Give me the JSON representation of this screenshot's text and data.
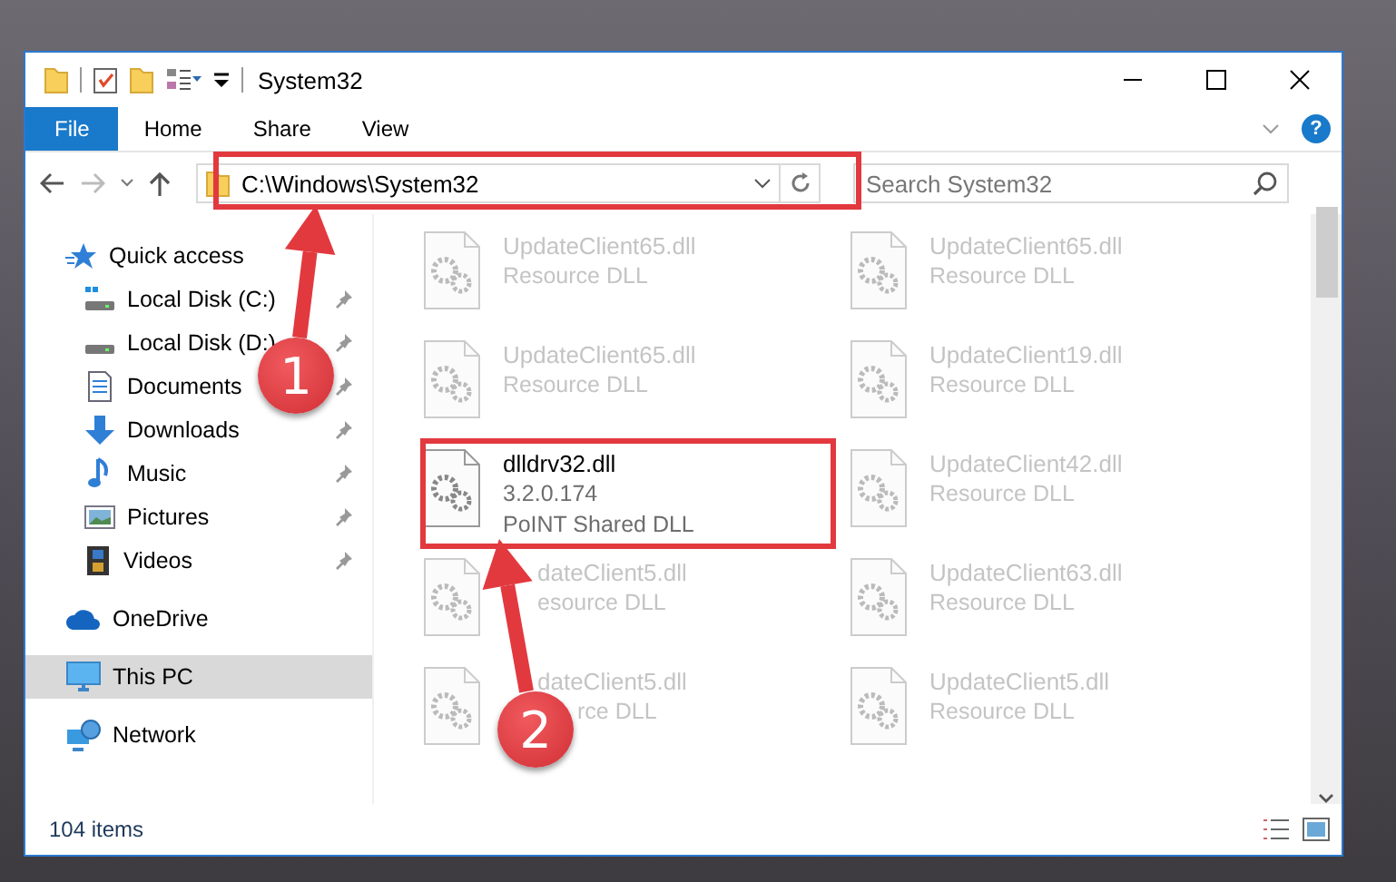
{
  "window": {
    "title": "System32",
    "controls": [
      {
        "kind": "minimize"
      },
      {
        "kind": "maximize"
      },
      {
        "kind": "close"
      }
    ]
  },
  "ribbon_tabs": [
    {
      "label": "File",
      "kind": "file",
      "selected": false
    },
    {
      "label": "Home",
      "kind": "tab",
      "selected": false
    },
    {
      "label": "Share",
      "kind": "tab",
      "selected": false
    },
    {
      "label": "View",
      "kind": "tab",
      "selected": false
    }
  ],
  "help_button": {
    "label": "?"
  },
  "address_bar": {
    "path": "C:\\Windows\\System32"
  },
  "search": {
    "placeholder": "Search System32"
  },
  "sidebar": {
    "items": [
      {
        "label": "Quick access",
        "kind": "star",
        "selected": false,
        "children": [
          {
            "label": "Local Disk (C:)",
            "kind": "system-drive",
            "pinned": true,
            "selected": false
          },
          {
            "label": "Local Disk (D:)",
            "kind": "drive",
            "pinned": true,
            "selected": false
          },
          {
            "label": "Documents",
            "kind": "documents",
            "pinned": true,
            "selected": false
          },
          {
            "label": "Downloads",
            "kind": "downloads",
            "pinned": true,
            "selected": false
          },
          {
            "label": "Music",
            "kind": "music",
            "pinned": true,
            "selected": false
          },
          {
            "label": "Pictures",
            "kind": "pictures",
            "pinned": true,
            "selected": false
          },
          {
            "label": "Videos",
            "kind": "videos",
            "pinned": true,
            "selected": false
          }
        ]
      },
      {
        "label": "OneDrive",
        "kind": "cloud",
        "selected": false
      },
      {
        "label": "This PC",
        "kind": "pc",
        "selected": true
      },
      {
        "label": "Network",
        "kind": "network",
        "selected": false
      }
    ]
  },
  "files": [
    {
      "name": "UpdateClient65.dll",
      "details": [
        "Resource DLL"
      ],
      "blurred": true
    },
    {
      "name": "UpdateClient65.dll",
      "details": [
        "Resource DLL"
      ],
      "blurred": true
    },
    {
      "name": "UpdateClient65.dll",
      "details": [
        "Resource DLL"
      ],
      "blurred": true
    },
    {
      "name": "UpdateClient19.dll",
      "details": [
        "Resource DLL"
      ],
      "blurred": true
    },
    {
      "name": "dlldrv32.dll",
      "details": [
        "3.2.0.174",
        "PoINT Shared DLL"
      ],
      "blurred": false
    },
    {
      "name": "UpdateClient42.dll",
      "details": [
        "Resource DLL"
      ],
      "blurred": true
    },
    {
      "name": "dateClient5.dll",
      "details": [
        "esource DLL"
      ],
      "blurred": true,
      "under_arrow": true
    },
    {
      "name": "UpdateClient63.dll",
      "details": [
        "Resource DLL"
      ],
      "blurred": true
    },
    {
      "name": "dateClient5.dll",
      "details": [
        "rce DLL"
      ],
      "blurred": true,
      "under_badge": true
    },
    {
      "name": "UpdateClient5.dll",
      "details": [
        "Resource DLL"
      ],
      "blurred": true
    }
  ],
  "status_bar": {
    "item_count": "104 items"
  },
  "callouts": [
    {
      "number": "1"
    },
    {
      "number": "2"
    }
  ]
}
